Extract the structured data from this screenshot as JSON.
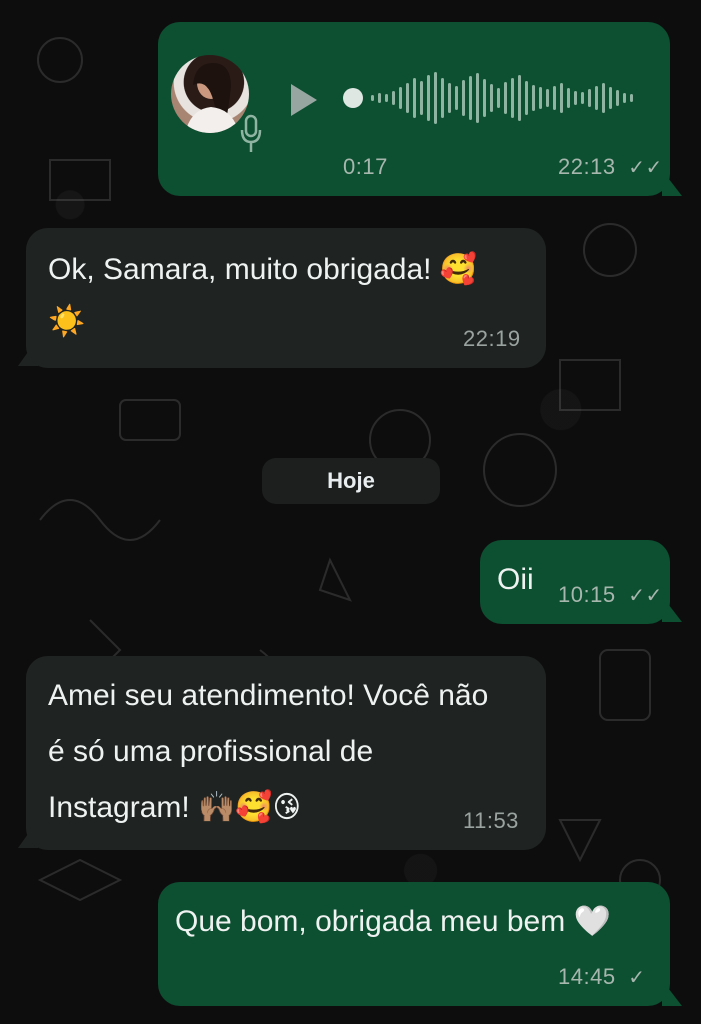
{
  "date_separator": "Hoje",
  "messages": [
    {
      "type": "audio",
      "direction": "outgoing",
      "duration": "0:17",
      "time": "22:13",
      "ticks": "✓✓"
    },
    {
      "type": "text",
      "direction": "incoming",
      "line1": "Ok, Samara, muito obrigada! 🥰",
      "line2": "☀️",
      "time": "22:19"
    },
    {
      "type": "text",
      "direction": "outgoing",
      "line1": "Oii",
      "time": "10:15",
      "ticks": "✓✓"
    },
    {
      "type": "text",
      "direction": "incoming",
      "line1": "Amei seu atendimento! Você não",
      "line2": "é só uma profissional de",
      "line3": "Instagram! 🙌🏽🥰😘",
      "time": "11:53"
    },
    {
      "type": "text",
      "direction": "outgoing",
      "line1": "Que bom, obrigada meu bem 🤍",
      "time": "14:45",
      "ticks": "✓"
    }
  ],
  "colors": {
    "outgoing": "#0d4f31",
    "incoming": "#1f2422",
    "background": "#0d0d0d"
  },
  "icons": {
    "play": "play-icon",
    "mic": "microphone-icon"
  }
}
